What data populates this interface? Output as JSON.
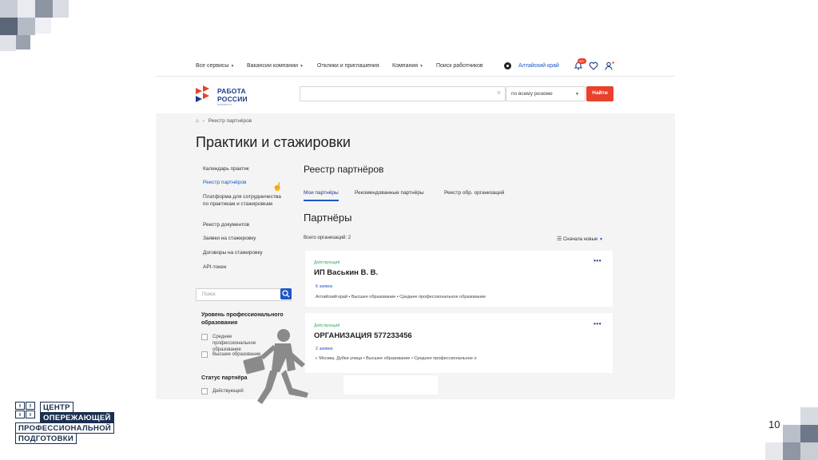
{
  "slide": {
    "page_number": "10",
    "footer_logo": {
      "lines": [
        "ЦЕНТР",
        "ОПЕРЕЖАЮЩЕЙ",
        "ПРОФЕССИОНАЛЬНОЙ",
        "ПОДГОТОВКИ"
      ]
    }
  },
  "topnav": {
    "all_services": "Все сервисы",
    "vacancies": "Вакансии компании",
    "responses": "Отклики и приглашения",
    "company": "Компания",
    "find_workers": "Поиск работников",
    "region": "Алтайский край",
    "notifications_badge": "99+"
  },
  "header": {
    "logo_line1": "РАБОТА",
    "logo_line2": "РОССИИ",
    "logo_sub": "trudvsem.ru",
    "search_value": "",
    "search_scope": "по всему резюме",
    "find_button": "Найти"
  },
  "breadcrumb": {
    "current": "Реестр партнёров"
  },
  "page_title": "Практики и стажировки",
  "sidebar": {
    "items": [
      {
        "label": "Календарь практик"
      },
      {
        "label": "Реестр партнёров"
      },
      {
        "label": "Платформа для сотрудничества по практикам и стажировкам"
      },
      {
        "label": "Реестр документов"
      },
      {
        "label": "Заявки на стажировку"
      },
      {
        "label": "Договоры на стажировку"
      },
      {
        "label": "API-токен"
      }
    ],
    "search_placeholder": "Поиск",
    "filters": [
      {
        "title": "Уровень профессионального образования",
        "options": [
          "Среднее профессиональное образование",
          "Высшее образование"
        ]
      },
      {
        "title": "Статус партнёра",
        "options": [
          "Действующий"
        ]
      }
    ]
  },
  "main": {
    "section_title": "Реестр партнёров",
    "tabs": [
      "Мои партнёры",
      "Рекомендованные партнёры",
      "Реестр обр. организаций"
    ],
    "partners_title": "Партнёры",
    "org_count": "Всего организаций: 2",
    "sort_label": "Сначала новые",
    "cards": [
      {
        "status": "Действующий",
        "name": "ИП Васькин В. В.",
        "apps": "6 заявок",
        "meta": "Алтайский край  •  Высшее образование  •  Среднее профессиональное образование"
      },
      {
        "status": "Действующий",
        "name": "ОРГАНИЗАЦИЯ 577233456",
        "apps": "2 заявки",
        "meta": "г. Москва, Дубки улица  •  Высшее образование  •  Среднее профессиональное о"
      }
    ]
  },
  "colors": {
    "brand_red": "#e8412c",
    "brand_blue": "#1d56c7",
    "status_green": "#3cab5a",
    "cop_navy": "#1a2e4f"
  }
}
